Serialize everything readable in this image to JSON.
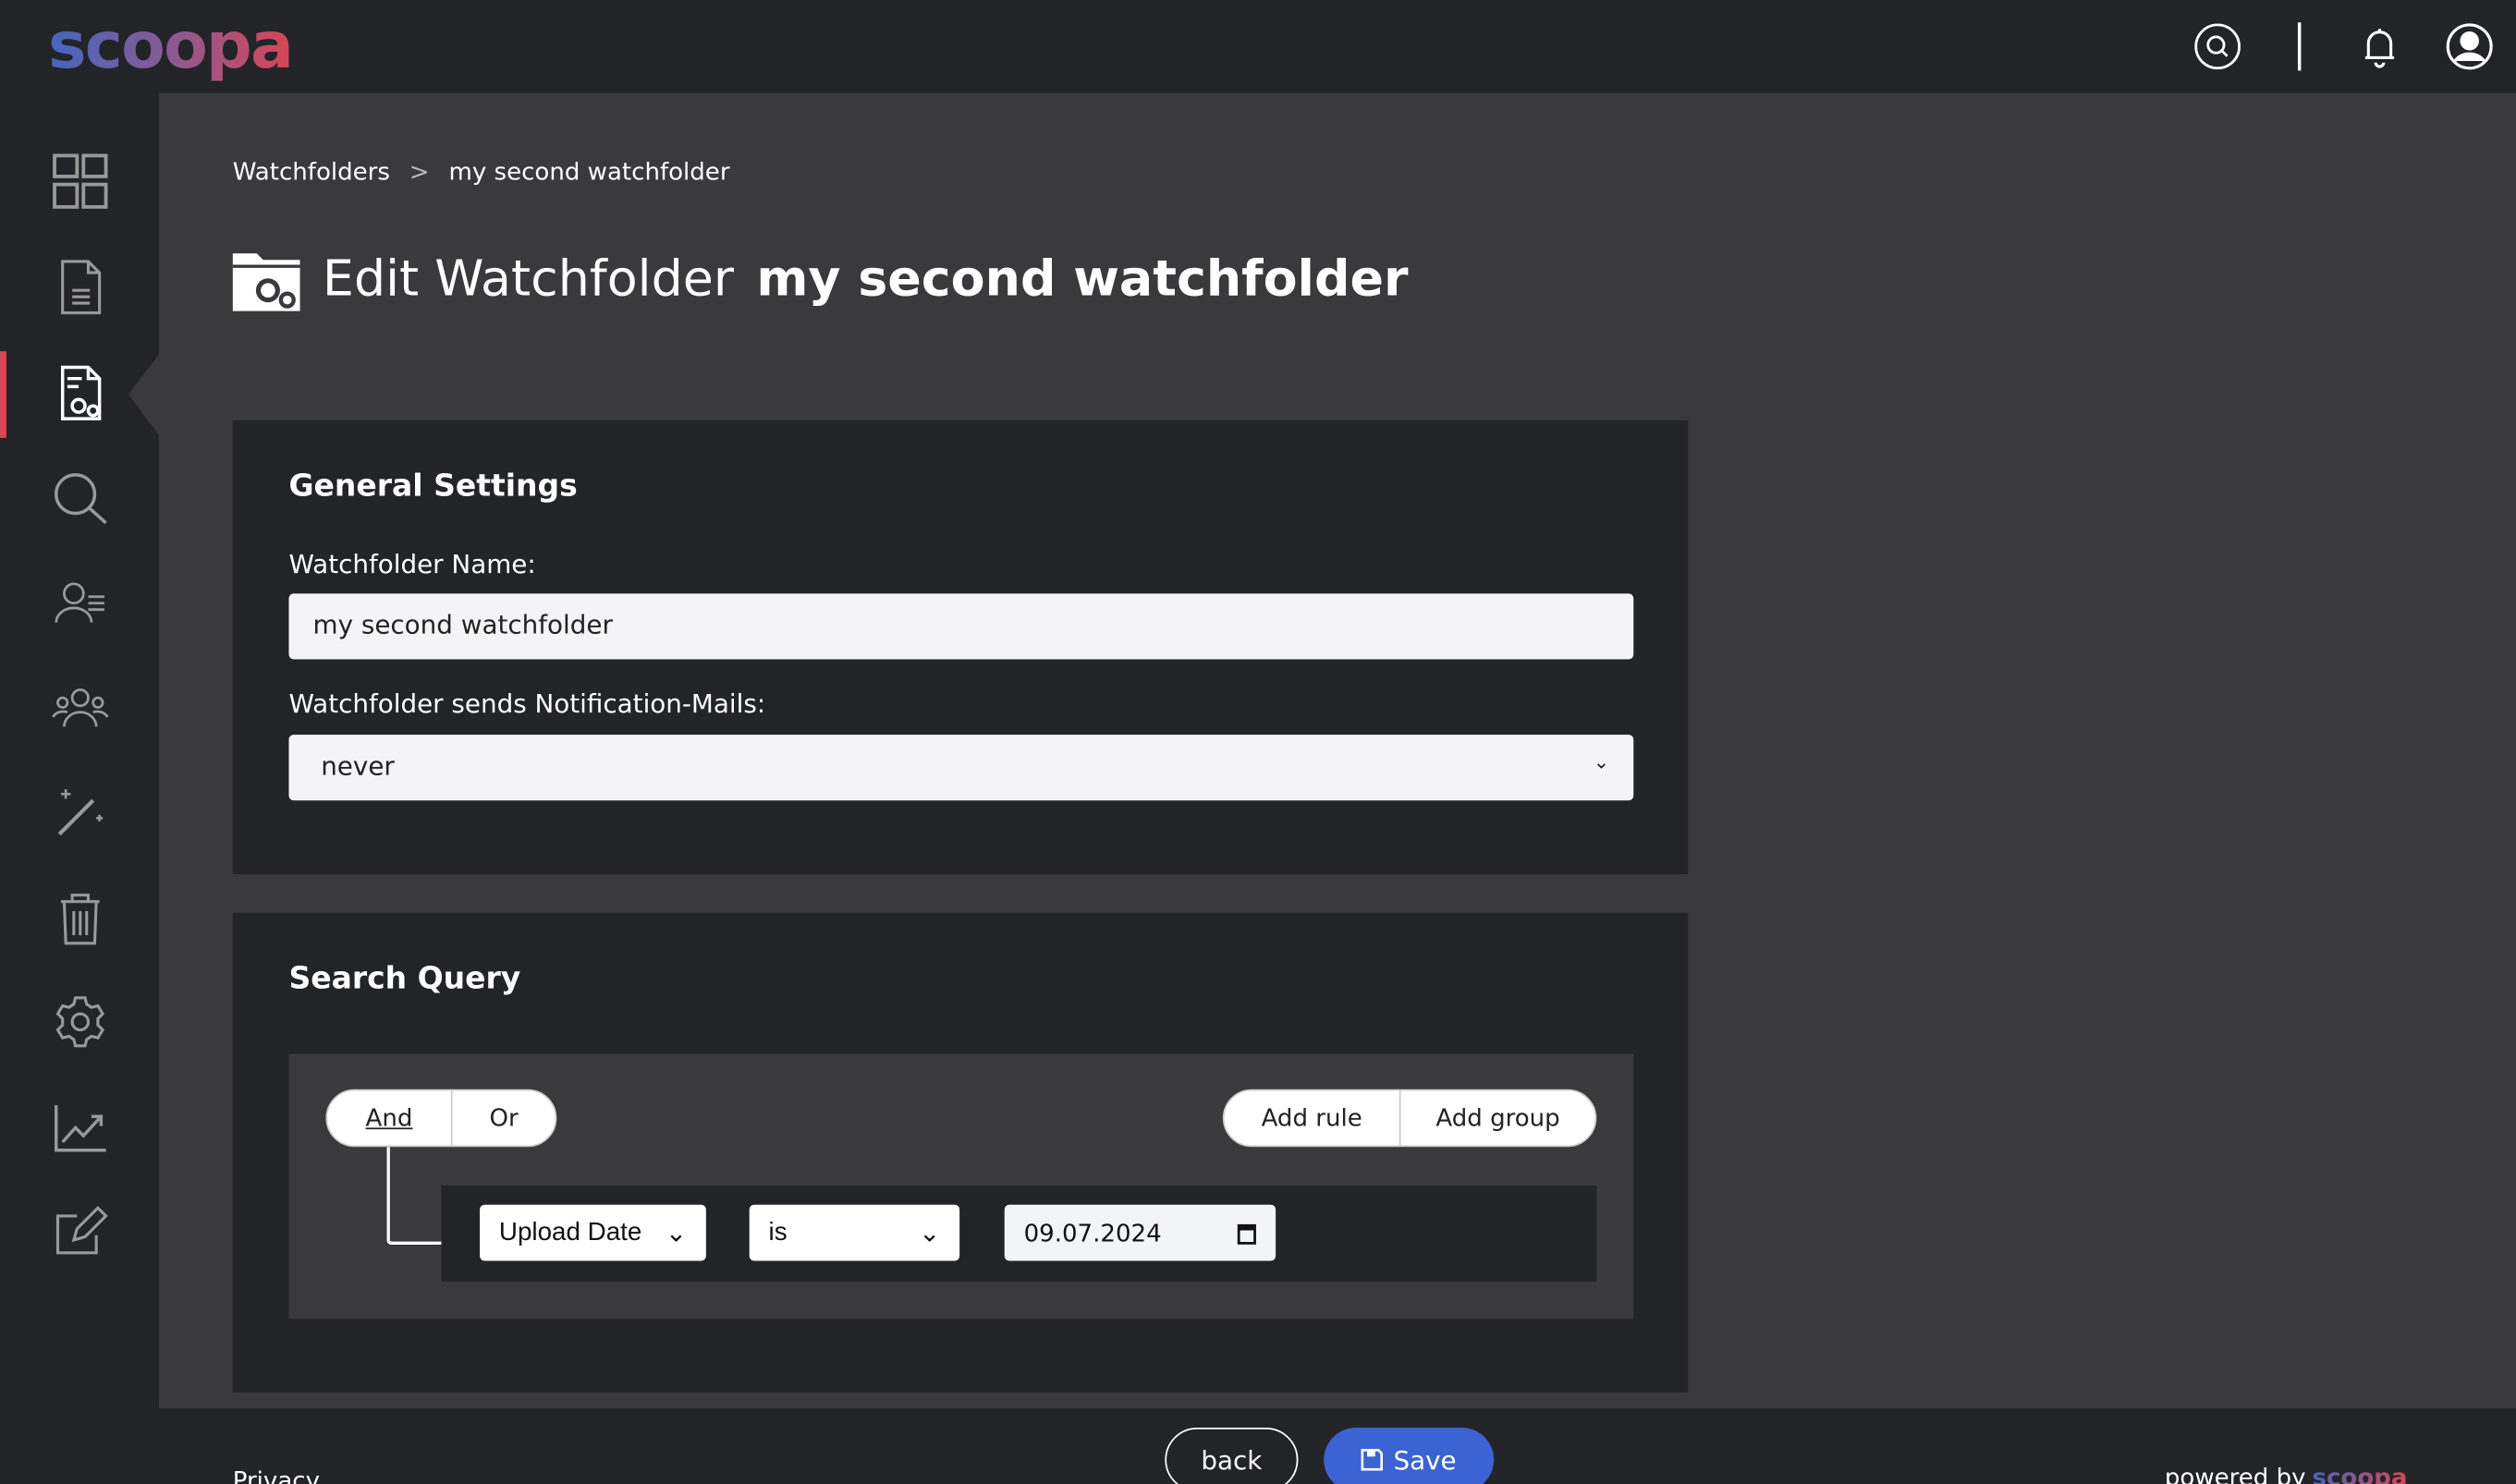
{
  "app": {
    "logo": "scoopa"
  },
  "topbar": {
    "icons": [
      "search-icon",
      "bell-icon",
      "user-account-icon"
    ]
  },
  "sidebar": {
    "items": [
      {
        "icon": "dashboard-grid-icon"
      },
      {
        "icon": "document-icon"
      },
      {
        "icon": "watchfolder-document-gear-icon",
        "active": true
      },
      {
        "icon": "search-icon"
      },
      {
        "icon": "user-list-icon"
      },
      {
        "icon": "users-group-icon"
      },
      {
        "icon": "magic-wand-icon"
      },
      {
        "icon": "trash-icon"
      },
      {
        "icon": "settings-gear-icon"
      },
      {
        "icon": "statistics-chart-icon"
      },
      {
        "icon": "edit-icon"
      }
    ],
    "accent": "#d84656"
  },
  "breadcrumb": {
    "items": [
      "Watchfolders",
      "my second watchfolder"
    ],
    "separator": ">"
  },
  "page": {
    "title_prefix": "Edit Watchfolder",
    "title_name": "my second watchfolder"
  },
  "general": {
    "heading": "General Settings",
    "name_label": "Watchfolder Name:",
    "name_value": "my second watchfolder",
    "mail_label": "Watchfolder sends Notification-Mails:",
    "mail_value": "never"
  },
  "query": {
    "heading": "Search Query",
    "combinators": [
      "And",
      "Or"
    ],
    "active_combinator": "And",
    "actions": [
      "Add rule",
      "Add group"
    ],
    "rule": {
      "field": "Upload Date",
      "operator": "is",
      "value": "09.07.2024"
    }
  },
  "footer": {
    "privacy": "Privacy",
    "back": "back",
    "save": "Save",
    "powered_by": "powered by",
    "save_color": "#3b63d3"
  }
}
